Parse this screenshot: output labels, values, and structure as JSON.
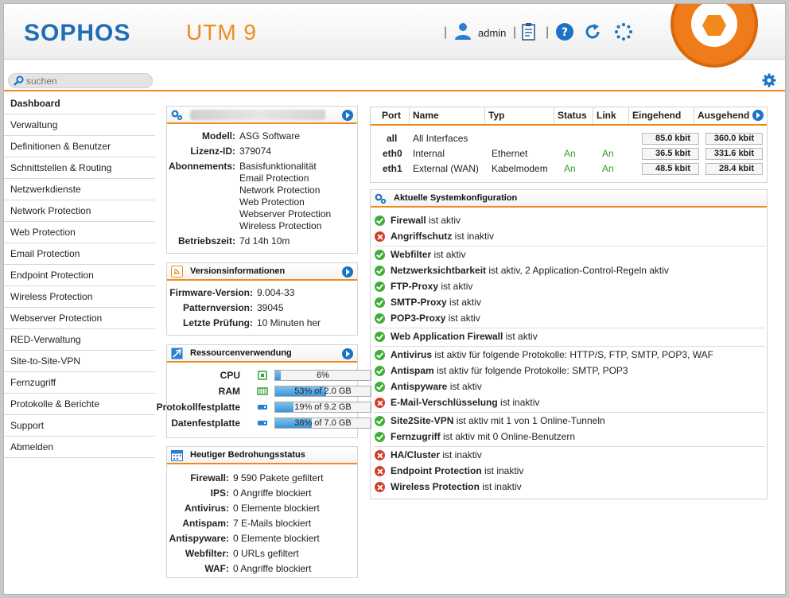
{
  "header": {
    "logo": "SOPHOS",
    "product": "UTM 9",
    "user": "admin",
    "icons": [
      "user-icon",
      "clipboard-icon",
      "help-icon",
      "reload-icon",
      "spinner-icon"
    ]
  },
  "search": {
    "placeholder": "suchen"
  },
  "sidebar": {
    "items": [
      {
        "label": "Dashboard"
      },
      {
        "label": "Verwaltung"
      },
      {
        "label": "Definitionen & Benutzer"
      },
      {
        "label": "Schnittstellen & Routing"
      },
      {
        "label": "Netzwerkdienste"
      },
      {
        "label": "Network Protection"
      },
      {
        "label": "Web Protection"
      },
      {
        "label": "Email Protection"
      },
      {
        "label": "Endpoint Protection"
      },
      {
        "label": "Wireless Protection"
      },
      {
        "label": "Webserver Protection"
      },
      {
        "label": "RED-Verwaltung"
      },
      {
        "label": "Site-to-Site-VPN"
      },
      {
        "label": "Fernzugriff"
      },
      {
        "label": "Protokolle & Berichte"
      },
      {
        "label": "Support"
      },
      {
        "label": "Abmelden"
      }
    ]
  },
  "system": {
    "model_label": "Modell:",
    "model": "ASG Software",
    "license_label": "Lizenz-ID:",
    "license": "379074",
    "subs_label": "Abonnements:",
    "subs": [
      "Basisfunktionalität",
      "Email Protection",
      "Network Protection",
      "Web Protection",
      "Webserver Protection",
      "Wireless Protection"
    ],
    "uptime_label": "Betriebszeit:",
    "uptime": "7d 14h 10m"
  },
  "versions": {
    "title": "Versionsinformationen",
    "fw_label": "Firmware-Version:",
    "fw": "9.004-33",
    "pattern_label": "Patternversion:",
    "pattern": "39045",
    "check_label": "Letzte Prüfung:",
    "check": "10 Minuten her"
  },
  "resources": {
    "title": "Ressourcenverwendung",
    "rows": [
      {
        "label": "CPU",
        "text": "6%",
        "percent": 6
      },
      {
        "label": "RAM",
        "text": "53% of 2.0 GB",
        "percent": 53
      },
      {
        "label": "Protokollfestplatte",
        "text": "19% of 9.2 GB",
        "percent": 19
      },
      {
        "label": "Datenfestplatte",
        "text": "38% of 7.0 GB",
        "percent": 38
      }
    ]
  },
  "threats": {
    "title": "Heutiger Bedrohungsstatus",
    "rows": [
      {
        "label": "Firewall:",
        "value": "9 590 Pakete gefiltert"
      },
      {
        "label": "IPS:",
        "value": "0 Angriffe blockiert"
      },
      {
        "label": "Antivirus:",
        "value": "0 Elemente blockiert"
      },
      {
        "label": "Antispam:",
        "value": "7 E-Mails blockiert"
      },
      {
        "label": "Antispyware:",
        "value": "0 Elemente blockiert"
      },
      {
        "label": "Webfilter:",
        "value": "0 URLs gefiltert"
      },
      {
        "label": "WAF:",
        "value": "0 Angriffe blockiert"
      }
    ]
  },
  "interfaces": {
    "headers": [
      "Port",
      "Name",
      "Typ",
      "Status",
      "Link",
      "Eingehend",
      "Ausgehend"
    ],
    "rows": [
      {
        "port": "all",
        "name": "All Interfaces",
        "type": "",
        "status": "",
        "link": "",
        "in": "85.0 kbit",
        "out": "360.0 kbit"
      },
      {
        "port": "eth0",
        "name": "Internal",
        "type": "Ethernet",
        "status": "An",
        "link": "An",
        "in": "36.5 kbit",
        "out": "331.6 kbit"
      },
      {
        "port": "eth1",
        "name": "External (WAN)",
        "type": "Kabelmodem",
        "status": "An",
        "link": "An",
        "in": "48.5 kbit",
        "out": "28.4 kbit"
      }
    ]
  },
  "config": {
    "title": "Aktuelle Systemkonfiguration",
    "items": [
      {
        "name": "Firewall",
        "text": " ist aktiv",
        "ok": true
      },
      {
        "name": "Angriffschutz",
        "text": " ist inaktiv",
        "ok": false
      },
      {
        "name": "Webfilter",
        "text": " ist aktiv",
        "ok": true
      },
      {
        "name": "Netzwerksichtbarkeit",
        "text": " ist aktiv, 2 Application-Control-Regeln aktiv",
        "ok": true
      },
      {
        "name": "FTP-Proxy",
        "text": " ist aktiv",
        "ok": true
      },
      {
        "name": "SMTP-Proxy",
        "text": " ist aktiv",
        "ok": true
      },
      {
        "name": "POP3-Proxy",
        "text": " ist aktiv",
        "ok": true
      },
      {
        "name": "Web Application Firewall",
        "text": " ist aktiv",
        "ok": true
      },
      {
        "name": "Antivirus",
        "text": " ist aktiv für folgende Protokolle: HTTP/S, FTP, SMTP, POP3, WAF",
        "ok": true
      },
      {
        "name": "Antispam",
        "text": " ist aktiv für folgende Protokolle: SMTP, POP3",
        "ok": true
      },
      {
        "name": "Antispyware",
        "text": " ist aktiv",
        "ok": true
      },
      {
        "name": "E-Mail-Verschlüsselung",
        "text": " ist inaktiv",
        "ok": false
      },
      {
        "name": "Site2Site-VPN",
        "text": " ist aktiv mit 1 von 1 Online-Tunneln",
        "ok": true
      },
      {
        "name": "Fernzugriff",
        "text": " ist aktiv mit 0 Online-Benutzern",
        "ok": true
      },
      {
        "name": "HA/Cluster",
        "text": " ist inaktiv",
        "ok": false
      },
      {
        "name": "Endpoint Protection",
        "text": " ist inaktiv",
        "ok": false
      },
      {
        "name": "Wireless Protection",
        "text": " ist inaktiv",
        "ok": false
      }
    ]
  },
  "colors": {
    "accent": "#f08a1c",
    "brand": "#1f6db6",
    "ok": "#3fae37",
    "bad": "#d33b2a"
  }
}
